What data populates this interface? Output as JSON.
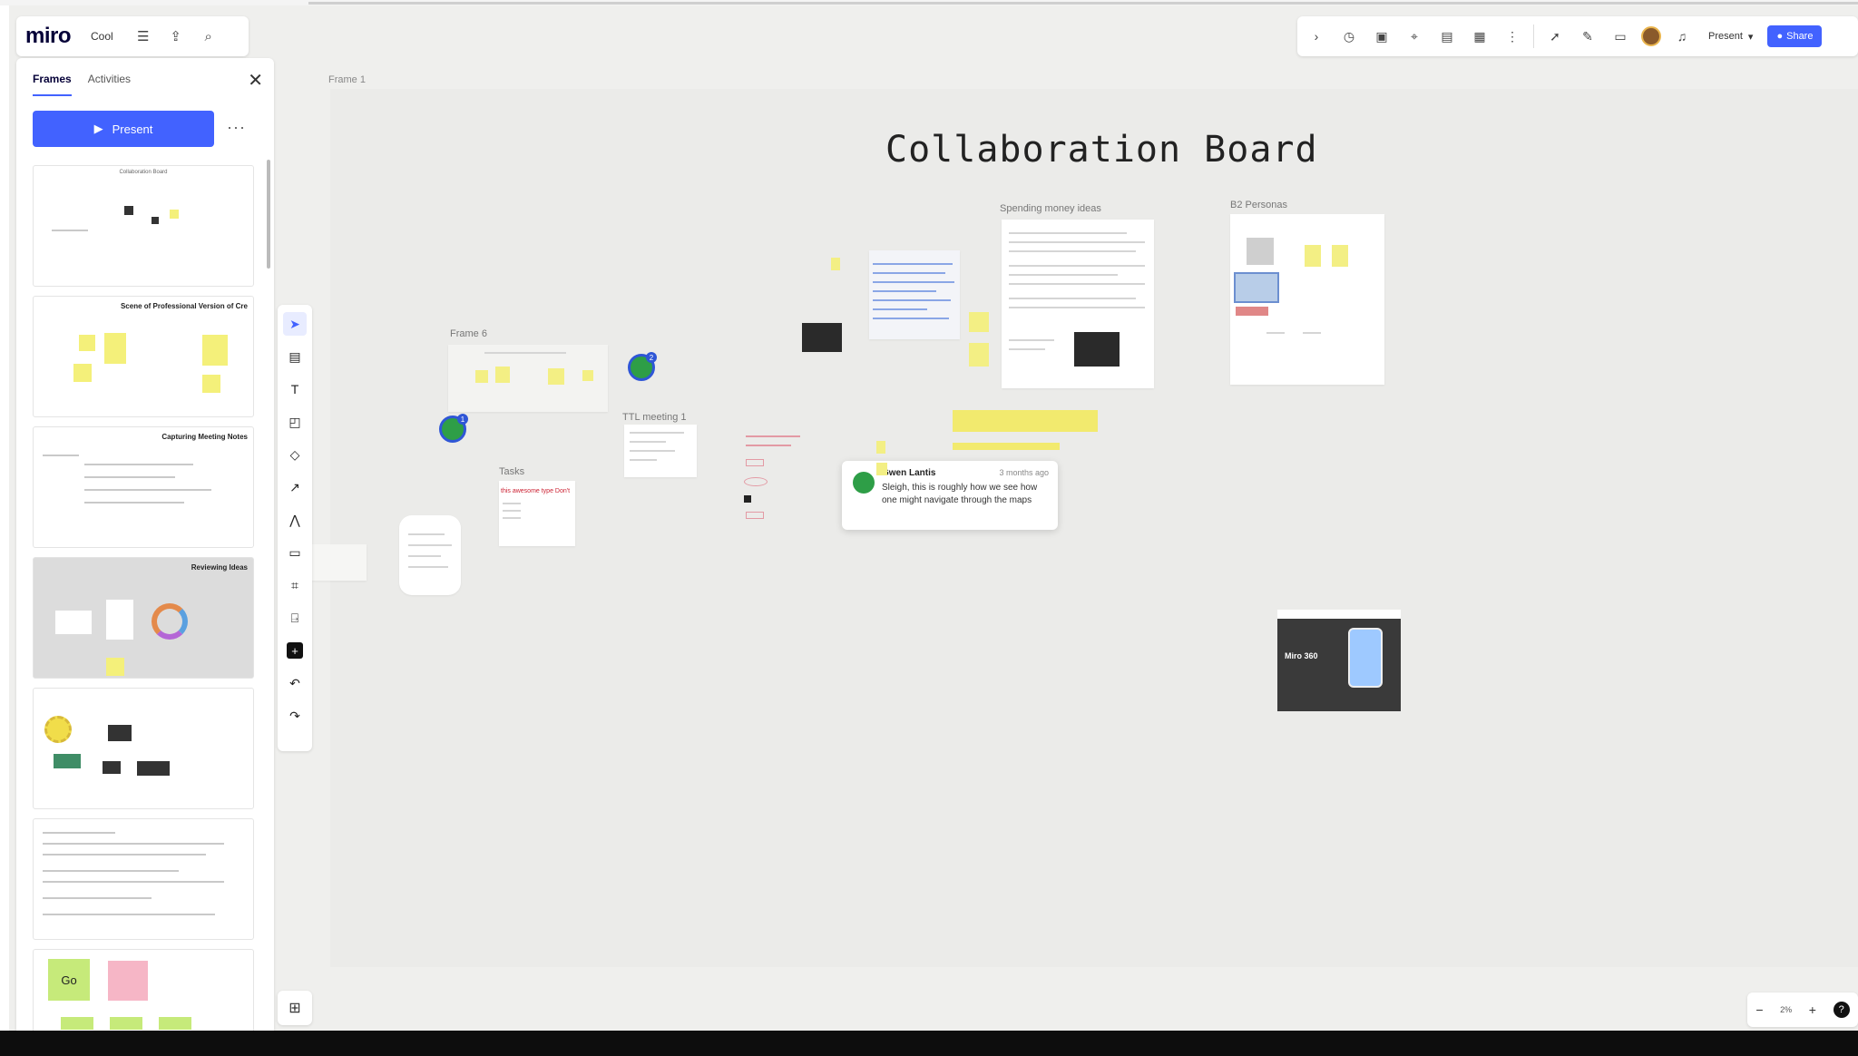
{
  "app": {
    "logo": "miro",
    "board_name": "Cool"
  },
  "top_left_icons": [
    "menu-icon",
    "upload-icon",
    "search-icon"
  ],
  "top_right": {
    "present_label": "Present",
    "share_label": "Share",
    "icons": [
      "chevron-icon",
      "timer-icon",
      "sticky-icon",
      "focus-icon",
      "notes-icon",
      "table-icon",
      "more-icon",
      "reaction-icon",
      "pen-icon",
      "board-icon",
      "avatar",
      "bell-icon"
    ]
  },
  "panel": {
    "tab_frames": "Frames",
    "tab_activities": "Activities",
    "present_button": "Present",
    "more": "···",
    "thumbs": [
      {
        "title": "",
        "center_title": "Collaboration Board"
      },
      {
        "title": "Scene of Professional Version of Cre"
      },
      {
        "title": "Capturing Meeting Notes"
      },
      {
        "title": "Reviewing Ideas"
      },
      {
        "title": ""
      },
      {
        "title": ""
      },
      {
        "title": "",
        "go_label": "Go"
      }
    ]
  },
  "canvas": {
    "frame_label": "Frame 1",
    "board_title": "Collaboration Board",
    "labels": {
      "frame6": "Frame 6",
      "tasks": "Tasks",
      "handwriting": "this awesome type Don't",
      "meeting": "TTL meeting 1",
      "marketing": "Spending money ideas",
      "personas": "B2 Personas"
    },
    "comment": {
      "author": "Gwen Lantis",
      "time": "3 months ago",
      "body": "Sleigh, this is roughly how we see how one might navigate through the maps"
    },
    "ad_text": "Miro 360"
  },
  "zoom": {
    "minus": "−",
    "value": "2%",
    "plus": "+",
    "help": "?"
  },
  "colors": {
    "accent": "#4262ff",
    "sticky": "#f3ef84",
    "canvas": "#efefed"
  }
}
